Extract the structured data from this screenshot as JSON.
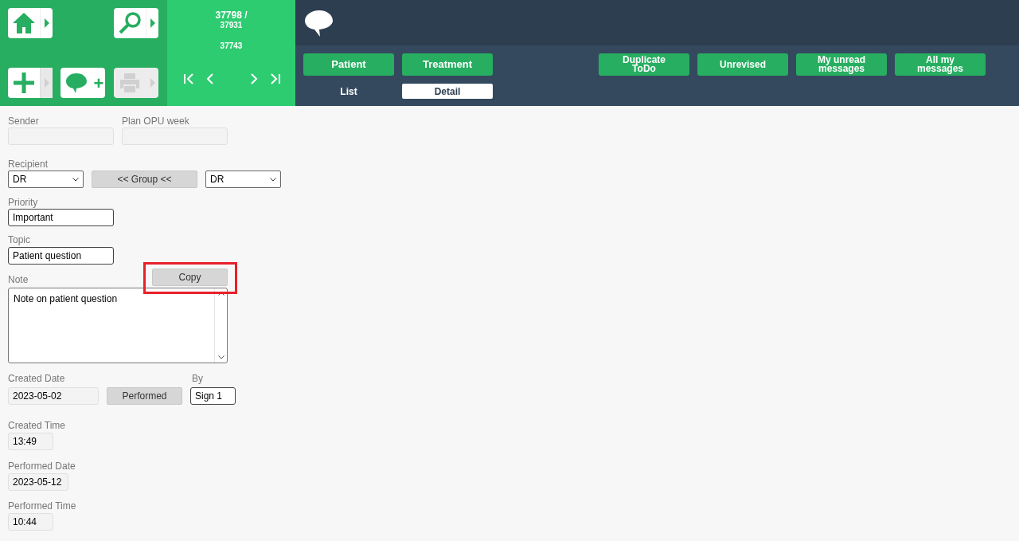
{
  "nav_buttons": [
    {
      "kind": "home",
      "disabled": false
    },
    {
      "kind": "search",
      "disabled": false
    },
    {
      "kind": "add",
      "disabled": false
    },
    {
      "kind": "new-message",
      "label": "+",
      "disabled": false
    },
    {
      "kind": "print",
      "disabled": true
    }
  ],
  "record_counter": {
    "current": "37798 /",
    "total": "37931",
    "other": "37743"
  },
  "view_buttons": [
    {
      "label": "Patient",
      "selected": true
    },
    {
      "label": "Treatment",
      "selected": true
    }
  ],
  "view_tabs": [
    {
      "label": "List",
      "selected": false
    },
    {
      "label": "Detail",
      "selected": true
    }
  ],
  "action_buttons": [
    "Duplicate ToDo",
    "Unrevised",
    "My unread messages",
    "All my messages"
  ],
  "form": {
    "sender": {
      "label": "Sender",
      "readonly": true
    },
    "plan_opu_week": {
      "label": "Plan OPU week",
      "readonly": true
    },
    "recipient": {
      "label": "Recipient",
      "value": "DR",
      "group_button": "<< Group <<",
      "group_value": "DR"
    },
    "priority": {
      "label": "Priority",
      "value": "Important",
      "readonly": false
    },
    "topic": {
      "label": "Topic",
      "value": "Patient question",
      "readonly": false
    },
    "copy_button": {
      "label": "Copy",
      "highlighted": true
    },
    "note": {
      "label": "Note",
      "value": "Note on patient question"
    },
    "created_date": {
      "label": "Created Date",
      "value": "2023-05-02",
      "readonly": true
    },
    "performed_button": "Performed",
    "by": {
      "label": "By",
      "value": "Sign 1",
      "readonly": false
    },
    "created_time": {
      "label": "Created Time",
      "value": "13:49",
      "readonly": true
    },
    "performed_date": {
      "label": "Performed Date",
      "value": "2023-05-12",
      "readonly": true
    },
    "performed_time": {
      "label": "Performed Time",
      "value": "10:44",
      "readonly": true
    }
  }
}
